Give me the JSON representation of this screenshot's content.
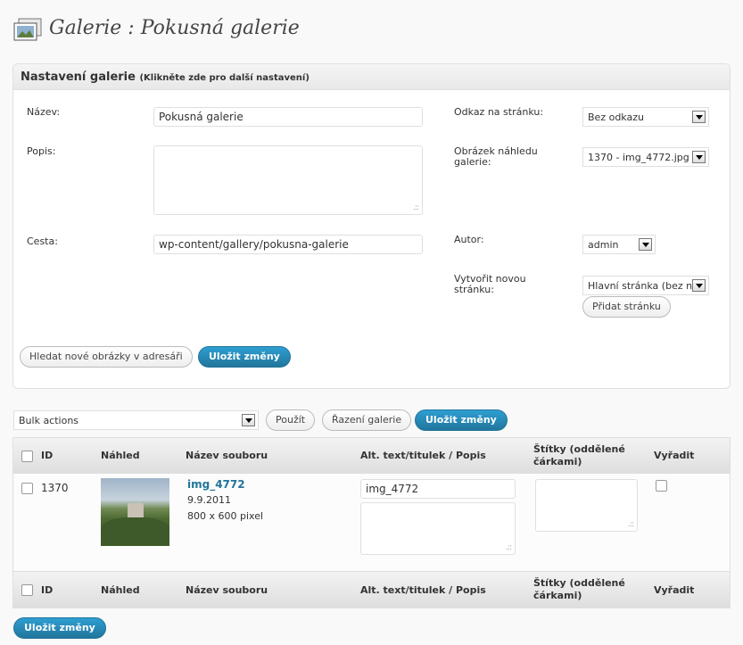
{
  "page": {
    "title": "Galerie : Pokusná galerie"
  },
  "settings": {
    "header": "Nastavení galerie",
    "header_hint": "(Klikněte zde pro další nastavení)",
    "name_label": "Název:",
    "name_value": "Pokusná galerie",
    "desc_label": "Popis:",
    "path_label": "Cesta:",
    "path_value": "wp-content/gallery/pokusna-galerie",
    "link_label": "Odkaz na stránku:",
    "link_value": "Bez odkazu",
    "preview_label_1": "Obrázek náhledu",
    "preview_label_2": "galerie:",
    "preview_value": "1370 - img_4772.jpg",
    "author_label": "Autor:",
    "author_value": "admin",
    "newpage_label_1": "Vytvořit novou",
    "newpage_label_2": "stránku:",
    "newpage_value": "Hlavní stránka (bez n",
    "add_page_button": "Přidat stránku",
    "scan_button": "Hledat nové obrázky v adresáři",
    "save_button": "Uložit změny"
  },
  "toolbar": {
    "bulk_value": "Bulk actions",
    "apply_button": "Použít",
    "sort_button": "Řazení galerie",
    "save_button": "Uložit změny"
  },
  "table": {
    "columns": {
      "id": "ID",
      "thumb": "Náhled",
      "filename": "Název souboru",
      "alt": "Alt. text/titulek / Popis",
      "tags_1": "Štítky (oddělené",
      "tags_2": "čárkami)",
      "exclude": "Vyřadit"
    },
    "rows": [
      {
        "id": "1370",
        "filename": "img_4772",
        "date": "9.9.2011",
        "size": "800 x 600 pixel",
        "alt": "img_4772"
      }
    ]
  },
  "footer": {
    "save_button": "Uložit změny"
  },
  "colors": {
    "primary": "#21759b",
    "background": "#f9f9f9"
  }
}
